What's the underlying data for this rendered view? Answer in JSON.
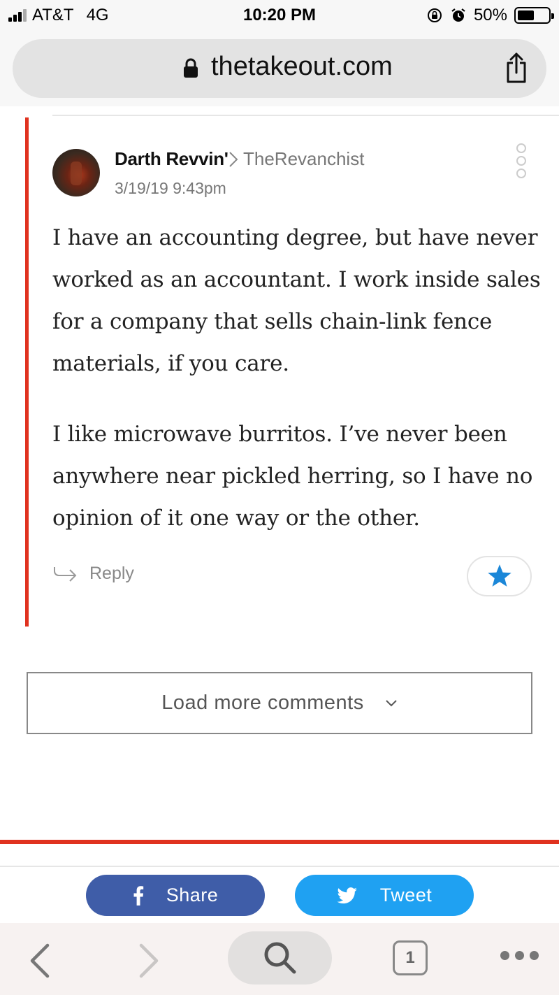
{
  "status_bar": {
    "carrier": "AT&T",
    "network": "4G",
    "time": "10:20 PM",
    "battery": "50%",
    "battery_level": 0.5
  },
  "browser": {
    "url": "thetakeout.com"
  },
  "comment": {
    "author": "Darth Revvin'",
    "reply_to": "TheRevanchist",
    "timestamp": "3/19/19 9:43pm",
    "paragraphs": [
      "I have an accounting degree, but have never worked as an accountant. I work inside sales for a company that sells chain-link fence materials, if you care.",
      "I like microwave burritos.  I’ve never been anywhere near pickled herring, so I have no opinion of it one way or the other."
    ],
    "reply_label": "Reply",
    "accent_color": "#e0321f",
    "star_color": "#1b87d8"
  },
  "load_more": {
    "label": "Load more comments"
  },
  "share": {
    "facebook_label": "Share",
    "twitter_label": "Tweet",
    "facebook_color": "#3f5da8",
    "twitter_color": "#1fa1f2"
  },
  "toolbar": {
    "tab_count": "1"
  }
}
